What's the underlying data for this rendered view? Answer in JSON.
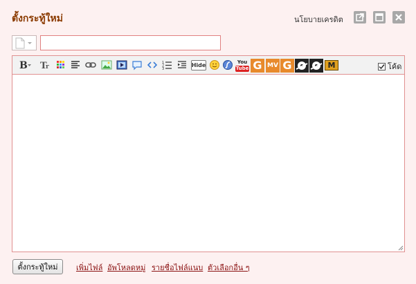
{
  "window": {
    "title": "ตั้งกระทู้ใหม่",
    "credit_link": "นโยบายเครดิต"
  },
  "window_controls": {
    "popout_icon": "popout-icon",
    "maximize_icon": "maximize-icon",
    "close_icon": "close-icon"
  },
  "form": {
    "subject_value": "",
    "thread_type_icon": "document-icon"
  },
  "toolbar": {
    "buttons": [
      "bold",
      "font-size",
      "color",
      "align",
      "link",
      "image",
      "media",
      "quote",
      "code",
      "ordered-list",
      "indent",
      "hide",
      "smiley",
      "flash",
      "youtube",
      "g1",
      "mv",
      "g2",
      "g3",
      "m"
    ],
    "hide_label": "Hide",
    "youtube_label": "You Tube",
    "mv_label": "MV",
    "g_label": "G",
    "m_label": "M",
    "code_toggle_label": "โค้ด",
    "code_toggle_checked": true
  },
  "editor": {
    "content": ""
  },
  "footer": {
    "submit_label": "ตั้งกระทู้ใหม่",
    "links": [
      "เพิ่มไฟล์",
      "อัพโหลดหมู่",
      "รายชื่อไฟล์แนบ",
      "ตัวเลือกอื่น ๆ"
    ]
  },
  "colors": {
    "title": "#8a3a00",
    "link": "#8a1010",
    "border": "#e09090",
    "background": "#fdf1f1"
  }
}
